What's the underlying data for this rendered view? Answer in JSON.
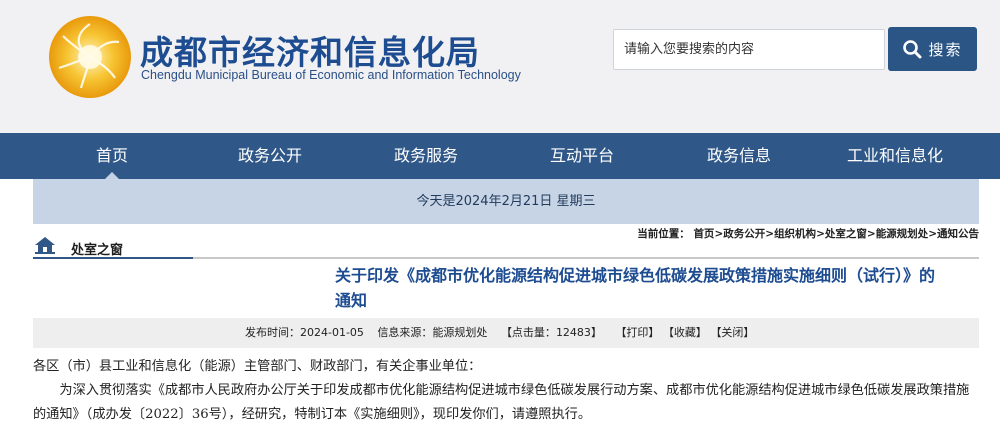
{
  "header": {
    "title": "成都市经济和信息化局",
    "subtitle": "Chengdu Municipal Bureau of Economic and Information Technology",
    "logo_icon": "sunburst-emblem-icon",
    "search_placeholder": "请输入您要搜索的内容",
    "search_button_label": "搜索"
  },
  "nav": {
    "items": [
      {
        "label": "首页"
      },
      {
        "label": "政务公开"
      },
      {
        "label": "政务服务"
      },
      {
        "label": "互动平台"
      },
      {
        "label": "政务信息"
      },
      {
        "label": "工业和信息化"
      }
    ],
    "active_index": 0
  },
  "date_bar": {
    "text": "今天是2024年2月21日 星期三"
  },
  "section": {
    "title": "处室之窗"
  },
  "breadcrumb": {
    "prefix": "当前位置：",
    "items": [
      "首页",
      "政务公开",
      "组织机构",
      "处室之窗",
      "能源规划处",
      "通知公告"
    ],
    "separator": ">"
  },
  "article": {
    "title": "关于印发《成都市优化能源结构促进城市绿色低碳发展政策措施实施细则（试行）》的通知",
    "meta": {
      "publish_label": "发布时间：",
      "publish_date": "2024-01-05",
      "source_label": "信息来源：",
      "source": "能源规划处",
      "hits_label": "【点击量：",
      "hits": "12483",
      "hits_suffix": "】",
      "print_label": "【打印】",
      "fav_label": "【收藏】",
      "close_label": "【关闭】"
    },
    "salutation": "各区（市）县工业和信息化（能源）主管部门、财政部门，有关企事业单位：",
    "paragraph1": "为深入贯彻落实《成都市人民政府办公厅关于印发成都市优化能源结构促进城市绿色低碳发展行动方案、成都市优化能源结构促进城市绿色低碳发展政策措施的通知》（成办发〔2022〕36号），经研究，特制订本《实施细则》，现印发你们，请遵照执行。"
  },
  "colors": {
    "brand_blue": "#1d4c91",
    "nav_bg": "#2f5889",
    "date_bar_bg": "#c7d4e6"
  }
}
